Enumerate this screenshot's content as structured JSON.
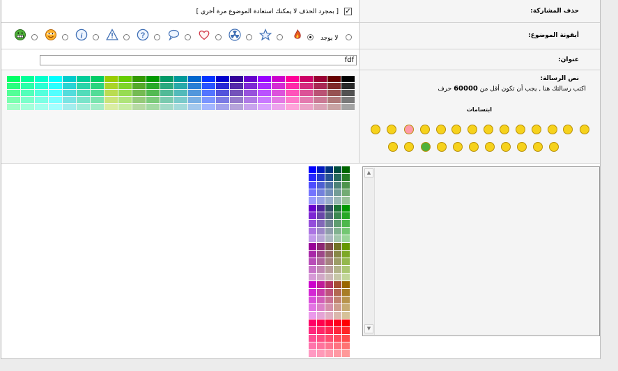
{
  "labels": {
    "delete": "حذف المشاركة:",
    "icons": "أيقونة الموضوع:",
    "title": "عنوان:",
    "body": "نص الرسالة:"
  },
  "delete_row": {
    "checked": true,
    "text": "[ بمجرد الحذف لا يمكنك استعادة الموضوع مرة أخرى ]"
  },
  "icons_row": {
    "none_label": "لا يوجد",
    "icons": [
      "fire-icon",
      "star-icon",
      "radioactive-icon",
      "heart-icon",
      "speech-bubble-icon",
      "question-icon",
      "warning-icon",
      "info-icon",
      "smiley-orange-icon",
      "grin-green-icon"
    ]
  },
  "title_row": {
    "value": "fdf"
  },
  "body_row": {
    "hint_pre": "اكتب رسالتك هنا , يجب أن تكون أقل من",
    "limit": "60000",
    "hint_post": "حرف",
    "smilies_title": "ابتسامات",
    "smilies": [
      "smile-big",
      "grin",
      "wink",
      "tongue",
      "surprised",
      "cool-glasses",
      "rolleyes",
      "smile",
      "happy",
      "embarrassed",
      "sad",
      "angry",
      "evil-grin",
      "laughing",
      "confused",
      "idea",
      "arrow",
      "neutral",
      "grin-green",
      "sunglasses",
      "nerd"
    ]
  },
  "colors": {
    "accent": "#f6d21c"
  }
}
